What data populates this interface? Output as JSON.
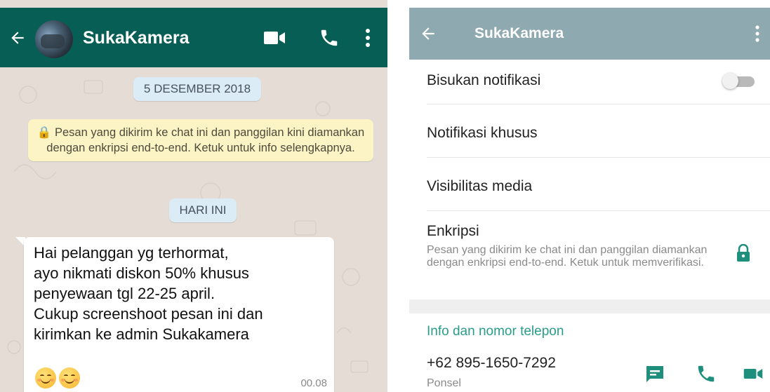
{
  "chat": {
    "contact_name": "SukaKamera",
    "date_label": "5 DESEMBER 2018",
    "encryption_notice": "🔒 Pesan yang dikirim ke chat ini dan panggilan kini diamankan dengan enkripsi end-to-end. Ketuk untuk info selengkapnya.",
    "today_label": "HARI INI",
    "message": {
      "text": "Hai pelanggan yg terhormat,\nayo nikmati diskon 50% khusus\npenyewaan tgl 22-25 april.\nCukup screenshoot pesan ini dan\nkirimkan ke  admin Sukakamera",
      "time": "00.08",
      "emojis": [
        "smiling-face",
        "smiling-face"
      ]
    },
    "header_icons": [
      "back-arrow-icon",
      "video-call-icon",
      "phone-icon",
      "more-vert-icon"
    ]
  },
  "info": {
    "title": "SukaKamera",
    "mute_label": "Bisukan notifikasi",
    "mute_enabled": false,
    "custom_notif_label": "Notifikasi khusus",
    "media_visibility_label": "Visibilitas media",
    "encryption_title": "Enkripsi",
    "encryption_desc": "Pesan yang dikirim ke chat ini dan panggilan diamankan dengan enkripsi end-to-end. Ketuk untuk memverifikasi.",
    "section_title": "Info dan nomor telepon",
    "phone_number": "+62 895-1650-7292",
    "phone_type": "Ponsel"
  },
  "colors": {
    "chat_header": "#075e54",
    "info_header": "#8fa9b0",
    "accent": "#2a9d8a",
    "system_note": "#fcf4c4",
    "date_pill": "#dcecf6"
  }
}
